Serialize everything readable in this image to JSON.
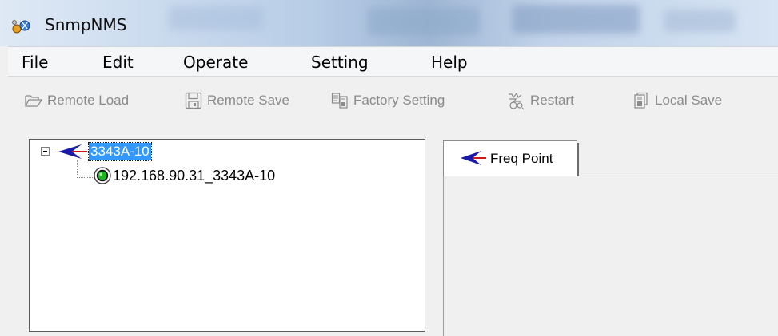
{
  "window": {
    "title": "SnmpNMS",
    "icon": "snmp-app-icon"
  },
  "menu": {
    "items": [
      {
        "label": "File"
      },
      {
        "label": "Edit"
      },
      {
        "label": "Operate"
      },
      {
        "label": "Setting"
      },
      {
        "label": "Help"
      }
    ]
  },
  "toolbar": {
    "items": [
      {
        "label": "Remote Load",
        "icon": "folder-open-icon",
        "enabled": false
      },
      {
        "label": "Remote Save",
        "icon": "floppy-disk-icon",
        "enabled": false
      },
      {
        "label": "Factory Setting",
        "icon": "factory-setting-icon",
        "enabled": false
      },
      {
        "label": "Restart",
        "icon": "restart-icon",
        "enabled": false
      },
      {
        "label": "Local Save",
        "icon": "local-save-icon",
        "enabled": false
      }
    ]
  },
  "tree": {
    "root": {
      "label": "3343A-10",
      "icon": "arrow-logo-icon",
      "expanded": true,
      "selected": true
    },
    "children": [
      {
        "label": "192.168.90.31_3343A-10",
        "icon": "green-status-icon"
      }
    ]
  },
  "tabs": [
    {
      "label": "Freq Point",
      "icon": "arrow-logo-icon",
      "active": true
    }
  ],
  "colors": {
    "selection": "#3399ff",
    "status_ok": "#1db81d",
    "logo_blue": "#1a1aa8",
    "logo_red": "#d01818",
    "disabled_text": "#8a8a8a"
  }
}
